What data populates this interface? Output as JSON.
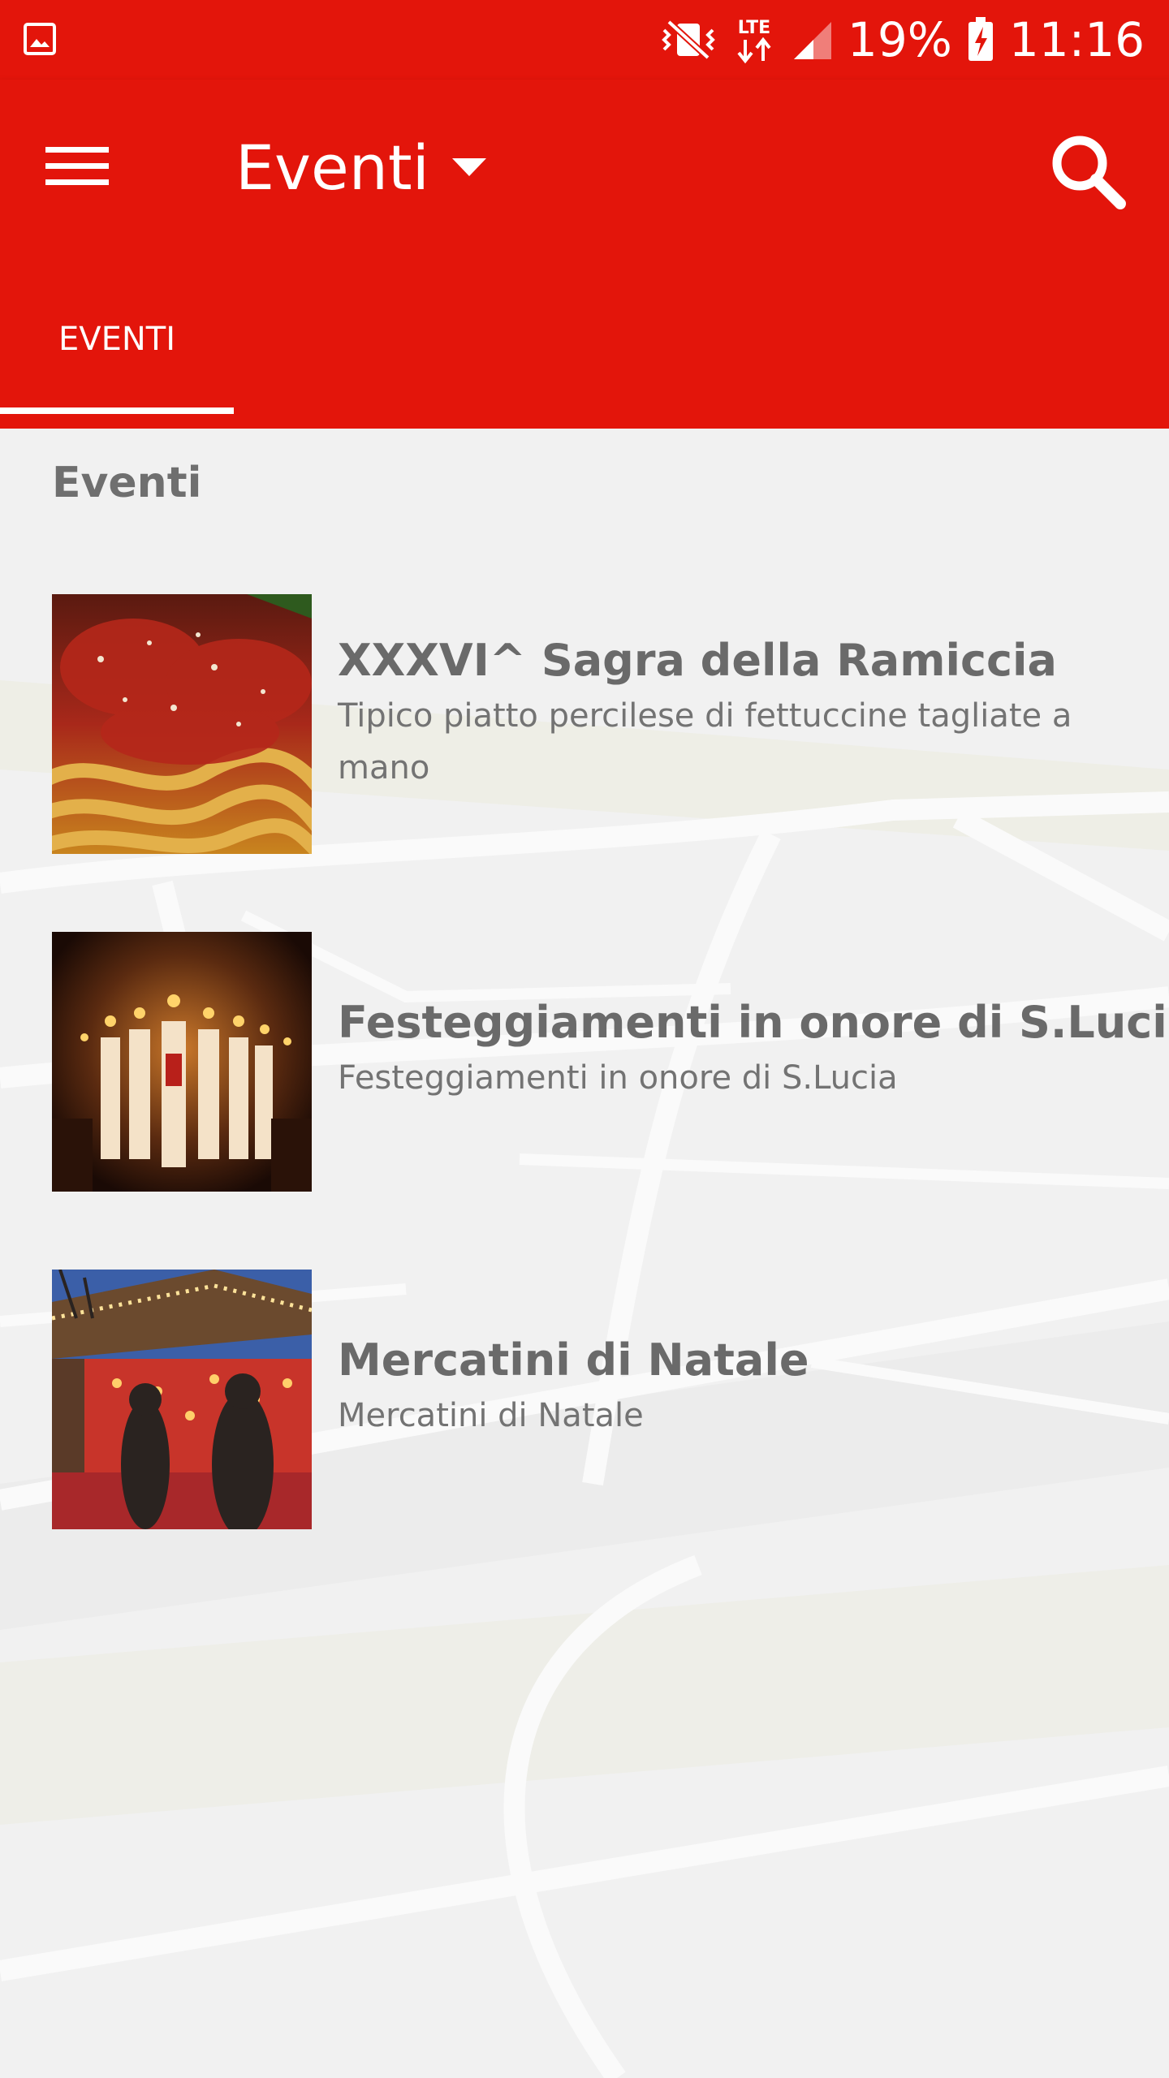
{
  "status_bar": {
    "battery": "19%",
    "time": "11:16",
    "network": "LTE",
    "icons": [
      "gallery-icon",
      "vibrate-mute-icon",
      "lte-icon",
      "signal-icon",
      "battery-charging-icon"
    ]
  },
  "app_bar": {
    "title": "Eventi",
    "menu_icon": "hamburger-menu-icon",
    "dropdown_icon": "caret-down-icon",
    "search_icon": "search-icon",
    "background_color": "#e3150b"
  },
  "tabs": [
    {
      "label": "EVENTI",
      "selected": true
    }
  ],
  "section": {
    "heading": "Eventi"
  },
  "events": [
    {
      "title": "XXXVI^ Sagra della Ramiccia",
      "description": "Tipico piatto percilese di fettuccine tagliate a mano"
    },
    {
      "title": "Festeggiamenti in onore di S.Lucia",
      "description": "Festeggiamenti in onore di S.Lucia"
    },
    {
      "title": "Mercatini di Natale",
      "description": "Mercatini di Natale"
    }
  ]
}
